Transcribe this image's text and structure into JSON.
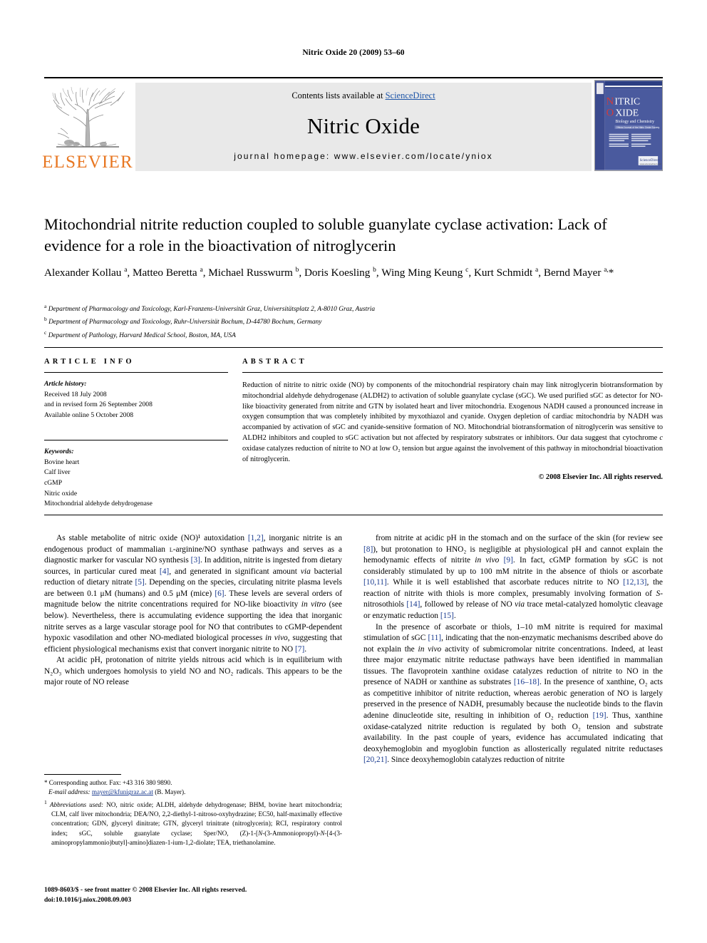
{
  "running_head": "Nitric Oxide 20 (2009) 53–60",
  "masthead": {
    "contents_prefix": "Contents lists available at ",
    "sciencedirect": "ScienceDirect",
    "journal_name": "Nitric Oxide",
    "homepage": "journal homepage: www.elsevier.com/locate/yniox",
    "publisher": "ELSEVIER",
    "cover_title_line1": "NITRIC",
    "cover_title_line2": "OXIDE",
    "cover_subtitle": "Biology and Chemistry",
    "cover_sub2": "Official Journal of the Nitric Oxide Society"
  },
  "article": {
    "title": "Mitochondrial nitrite reduction coupled to soluble guanylate cyclase activation: Lack of evidence for a role in the bioactivation of nitroglycerin",
    "authors_html": "Alexander Kollau <sup>a</sup>, Matteo Beretta <sup>a</sup>, Michael Russwurm <sup>b</sup>, Doris Koesling <sup>b</sup>, Wing Ming Keung <sup>c</sup>, Kurt Schmidt <sup>a</sup>, Bernd Mayer <sup>a,</sup>*",
    "affiliations": [
      {
        "marker": "a",
        "text": "Department of Pharmacology and Toxicology, Karl-Franzens-Universität Graz, Universitätsplatz 2, A-8010 Graz, Austria"
      },
      {
        "marker": "b",
        "text": "Department of Pharmacology and Toxicology, Ruhr-Universität Bochum, D-44780 Bochum, Germany"
      },
      {
        "marker": "c",
        "text": "Department of Pathology, Harvard Medical School, Boston, MA, USA"
      }
    ]
  },
  "article_info": {
    "heading": "ARTICLE INFO",
    "history_label": "Article history:",
    "history_lines": [
      "Received 18 July 2008",
      "and in revised form 26 September 2008",
      "Available online 5 October 2008"
    ],
    "keywords_label": "Keywords:",
    "keywords": [
      "Bovine heart",
      "Calf liver",
      "cGMP",
      "Nitric oxide",
      "Mitochondrial aldehyde dehydrogenase"
    ]
  },
  "abstract": {
    "heading": "ABSTRACT",
    "text": "Reduction of nitrite to nitric oxide (NO) by components of the mitochondrial respiratory chain may link nitroglycerin biotransformation by mitochondrial aldehyde dehydrogenase (ALDH2) to activation of soluble guanylate cyclase (sGC). We used purified sGC as detector for NO-like bioactivity generated from nitrite and GTN by isolated heart and liver mitochondria. Exogenous NADH caused a pronounced increase in oxygen consumption that was completely inhibited by myxothiazol and cyanide. Oxygen depletion of cardiac mitochondria by NADH was accompanied by activation of sGC and cyanide-sensitive formation of NO. Mitochondrial biotransformation of nitroglycerin was sensitive to ALDH2 inhibitors and coupled to sGC activation but not affected by respiratory substrates or inhibitors. Our data suggest that cytochrome c oxidase catalyzes reduction of nitrite to NO at low O₂ tension but argue against the involvement of this pathway in mitochondrial bioactivation of nitroglycerin.",
    "copyright": "© 2008 Elsevier Inc. All rights reserved."
  },
  "body": {
    "left_paragraphs": [
      "As stable metabolite of nitric oxide (NO)¹ autoxidation [1,2], inorganic nitrite is an endogenous product of mammalian ʟ-arginine/NO synthase pathways and serves as a diagnostic marker for vascular NO synthesis [3]. In addition, nitrite is ingested from dietary sources, in particular cured meat [4], and generated in significant amount via bacterial reduction of dietary nitrate [5]. Depending on the species, circulating nitrite plasma levels are between 0.1 μM (humans) and 0.5 μM (mice) [6]. These levels are several orders of magnitude below the nitrite concentrations required for NO-like bioactivity in vitro (see below). Nevertheless, there is accumulating evidence supporting the idea that inorganic nitrite serves as a large vascular storage pool for NO that contributes to cGMP-dependent hypoxic vasodilation and other NO-mediated biological processes in vivo, suggesting that efficient physiological mechanisms exist that convert inorganic nitrite to NO [7].",
      "At acidic pH, protonation of nitrite yields nitrous acid which is in equilibrium with N₂O₃ which undergoes homolysis to yield NO and NO₂ radicals. This appears to be the major route of NO release"
    ],
    "right_paragraphs": [
      "from nitrite at acidic pH in the stomach and on the surface of the skin (for review see [8]), but protonation to HNO₂ is negligible at physiological pH and cannot explain the hemodynamic effects of nitrite in vivo [9]. In fact, cGMP formation by sGC is not considerably stimulated by up to 100 mM nitrite in the absence of thiols or ascorbate [10,11]. While it is well established that ascorbate reduces nitrite to NO [12,13], the reaction of nitrite with thiols is more complex, presumably involving formation of S-nitrosothiols [14], followed by release of NO via trace metal-catalyzed homolytic cleavage or enzymatic reduction [15].",
      "In the presence of ascorbate or thiols, 1–10 mM nitrite is required for maximal stimulation of sGC [11], indicating that the non-enzymatic mechanisms described above do not explain the in vivo activity of submicromolar nitrite concentrations. Indeed, at least three major enzymatic nitrite reductase pathways have been identified in mammalian tissues. The flavoprotein xanthine oxidase catalyzes reduction of nitrite to NO in the presence of NADH or xanthine as substrates [16–18]. In the presence of xanthine, O₂ acts as competitive inhibitor of nitrite reduction, whereas aerobic generation of NO is largely preserved in the presence of NADH, presumably because the nucleotide binds to the flavin adenine dinucleotide site, resulting in inhibition of O₂ reduction [19]. Thus, xanthine oxidase-catalyzed nitrite reduction is regulated by both O₂ tension and substrate availability. In the past couple of years, evidence has accumulated indicating that deoxyhemoglobin and myoglobin function as allosterically regulated nitrite reductases [20,21]. Since deoxyhemoglobin catalyzes reduction of nitrite"
    ]
  },
  "footnotes": {
    "corresponding": "Corresponding author. Fax: +43 316 380 9890.",
    "email_label": "E-mail address:",
    "email": "mayer@kfunigraz.ac.at",
    "email_suffix": "(B. Mayer).",
    "abbrev_label": "Abbreviations used:",
    "abbrev_text": "NO, nitric oxide; ALDH, aldehyde dehydrogenase; BHM, bovine heart mitochondria; CLM, calf liver mitochondria; DEA/NO, 2,2-diethyl-1-nitroso-oxyhydrazine; EC50, half-maximally effective concentration; GDN, glyceryl dinitrate; GTN, glyceryl trinitrate (nitroglycerin); RCI, respiratory control index; sGC, soluble guanylate cyclase; Sper/NO, (Z)-1-[N-(3-Ammoniopropyl)-N-[4-(3-aminopropylammonio)butyl]-amino]diazen-1-ium-1,2-diolate; TEA, triethanolamine."
  },
  "imprint": {
    "line1": "1089-8603/$ - see front matter © 2008 Elsevier Inc. All rights reserved.",
    "line2": "doi:10.1016/j.niox.2008.09.003"
  },
  "colors": {
    "elsevier_orange": "#E87722",
    "link_blue": "#1f56a8",
    "ref_blue": "#1a3b8f",
    "band_grey": "#e9e9e9",
    "cover_navy": "#2b3d82"
  }
}
